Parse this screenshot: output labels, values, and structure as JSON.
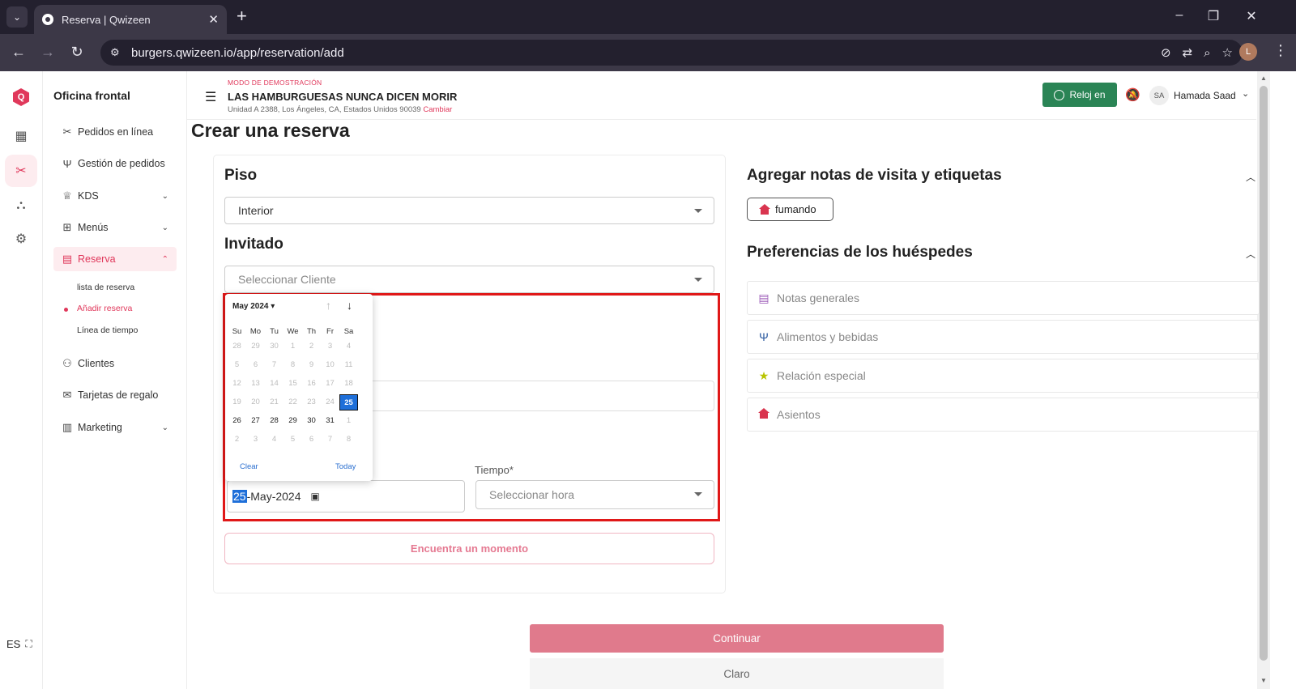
{
  "browser": {
    "tab_title": "Reserva | Qwizeen",
    "url": "burgers.qwizeen.io/app/reservation/add",
    "profile_initial": "L"
  },
  "rail": {
    "logo_letter": "Q",
    "lang": "ES"
  },
  "sidebar": {
    "brand": "Oficina frontal",
    "items": [
      {
        "label": "Pedidos en línea"
      },
      {
        "label": "Gestión de pedidos"
      },
      {
        "label": "KDS"
      },
      {
        "label": "Menús"
      },
      {
        "label": "Reserva"
      },
      {
        "label": "Clientes"
      },
      {
        "label": "Tarjetas de regalo"
      },
      {
        "label": "Marketing"
      }
    ],
    "sub_items": [
      {
        "label": "lista de reserva"
      },
      {
        "label": "Añadir reserva"
      },
      {
        "label": "Línea de tiempo"
      }
    ]
  },
  "topbar": {
    "demo_label": "MODO DE DEMOSTRACIÓN",
    "store_name": "LAS HAMBURGUESAS NUNCA DICEN MORIR",
    "store_address": "Unidad A 2388, Los Ángeles, CA, Estados Unidos 90039",
    "change_link": "Cambiar",
    "clock_button": "Reloj en",
    "user_initials": "SA",
    "user_name": "Hamada Saad"
  },
  "main": {
    "page_title": "Crear una reserva",
    "floor_label": "Piso",
    "floor_value": "Interior",
    "guest_label": "Invitado",
    "guest_placeholder": "Seleccionar Cliente",
    "time_label": "Tiempo*",
    "time_placeholder": "Seleccionar hora",
    "date_day": "25",
    "date_rest": "-May-2024",
    "find_button": "Encuentra un momento"
  },
  "datepicker": {
    "month_label": "May 2024",
    "weekdays": [
      "Su",
      "Mo",
      "Tu",
      "We",
      "Th",
      "Fr",
      "Sa"
    ],
    "weeks": [
      [
        "28",
        "29",
        "30",
        "1",
        "2",
        "3",
        "4"
      ],
      [
        "5",
        "6",
        "7",
        "8",
        "9",
        "10",
        "11"
      ],
      [
        "12",
        "13",
        "14",
        "15",
        "16",
        "17",
        "18"
      ],
      [
        "19",
        "20",
        "21",
        "22",
        "23",
        "24",
        "25"
      ],
      [
        "26",
        "27",
        "28",
        "29",
        "30",
        "31",
        "1"
      ],
      [
        "2",
        "3",
        "4",
        "5",
        "6",
        "7",
        "8"
      ]
    ],
    "selected_day": "25",
    "clear_label": "Clear",
    "today_label": "Today"
  },
  "right": {
    "notes_title": "Agregar notas de visita y etiquetas",
    "tag_label": "fumando",
    "prefs_title": "Preferencias de los huéspedes",
    "prefs": [
      {
        "label": "Notas generales"
      },
      {
        "label": "Alimentos y bebidas"
      },
      {
        "label": "Relación especial"
      },
      {
        "label": "Asientos"
      }
    ]
  },
  "footer": {
    "continue_button": "Continuar",
    "clear_button": "Claro"
  },
  "colors": {
    "accent": "#e0385b",
    "clock_green": "#2a8455",
    "selection_blue": "#1e6fd9",
    "highlight_red": "#e01818"
  }
}
